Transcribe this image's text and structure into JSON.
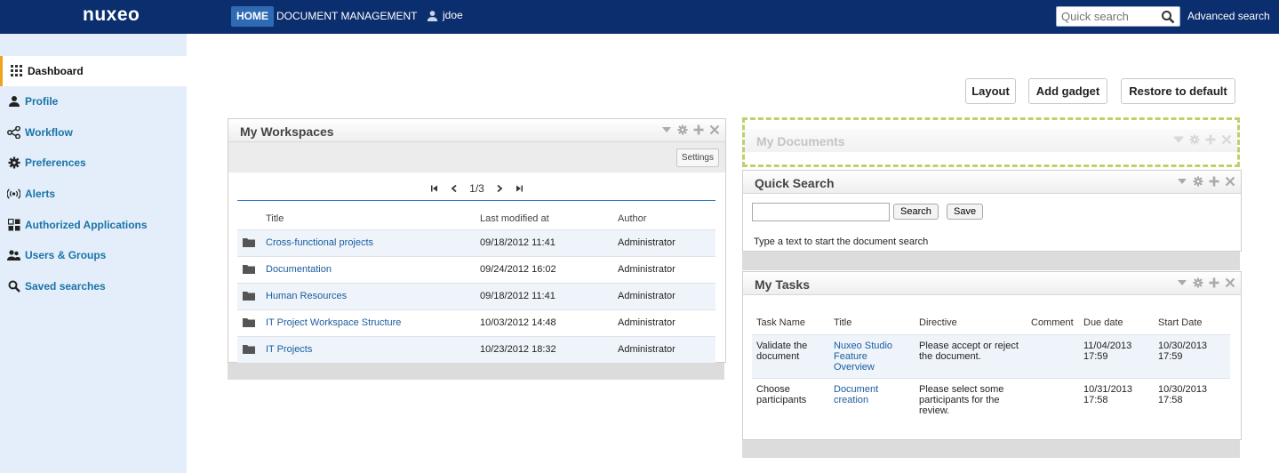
{
  "topbar": {
    "logo": "nuxeo",
    "nav_home": "HOME",
    "nav_doc_management": "DOCUMENT MANAGEMENT",
    "user": "jdoe",
    "quick_search_placeholder": "Quick search",
    "advanced_search": "Advanced search"
  },
  "sidebar": {
    "items": [
      {
        "label": "Dashboard",
        "icon": "grid-icon",
        "active": true
      },
      {
        "label": "Profile",
        "icon": "person-icon"
      },
      {
        "label": "Workflow",
        "icon": "workflow-icon"
      },
      {
        "label": "Preferences",
        "icon": "gear-icon"
      },
      {
        "label": "Alerts",
        "icon": "broadcast-icon"
      },
      {
        "label": "Authorized Applications",
        "icon": "apps-icon"
      },
      {
        "label": "Users & Groups",
        "icon": "users-icon"
      },
      {
        "label": "Saved searches",
        "icon": "search-icon"
      }
    ]
  },
  "actions": {
    "layout": "Layout",
    "add_gadget": "Add gadget",
    "restore_default": "Restore to default"
  },
  "workspaces": {
    "title": "My Workspaces",
    "settings": "Settings",
    "page": "1/3",
    "columns": [
      "Title",
      "Last modified at",
      "Author"
    ],
    "rows": [
      {
        "title": "Cross-functional projects",
        "modified": "09/18/2012 11:41",
        "author": "Administrator"
      },
      {
        "title": "Documentation",
        "modified": "09/24/2012 16:02",
        "author": "Administrator"
      },
      {
        "title": "Human Resources",
        "modified": "09/18/2012 11:41",
        "author": "Administrator"
      },
      {
        "title": "IT Project Workspace Structure",
        "modified": "10/03/2012 14:48",
        "author": "Administrator"
      },
      {
        "title": "IT Projects",
        "modified": "10/23/2012 18:32",
        "author": "Administrator"
      }
    ]
  },
  "my_documents": {
    "title": "My Documents"
  },
  "quick_search": {
    "title": "Quick Search",
    "search_btn": "Search",
    "save_btn": "Save",
    "hint": "Type a text to start the document search"
  },
  "tasks": {
    "title": "My Tasks",
    "columns": [
      "Task Name",
      "Title",
      "Directive",
      "Comment",
      "Due date",
      "Start Date"
    ],
    "rows": [
      {
        "name": "Validate the document",
        "title": "Nuxeo Studio Feature Overview",
        "directive": "Please accept or reject the document.",
        "comment": "",
        "due": "11/04/2013 17:59",
        "start": "10/30/2013 17:59"
      },
      {
        "name": "Choose participants",
        "title": "Document creation",
        "directive": "Please select some participants for the review.",
        "comment": "",
        "due": "10/31/2013 17:58",
        "start": "10/30/2013 17:58"
      }
    ]
  },
  "colors": {
    "topbar": "#0b2e6e",
    "accent": "#2f6bb5",
    "sidebar_bg": "#e3eefa",
    "link": "#1a5c9e",
    "active_marker": "#f0a21c",
    "drop_zone": "#b9d36a"
  }
}
